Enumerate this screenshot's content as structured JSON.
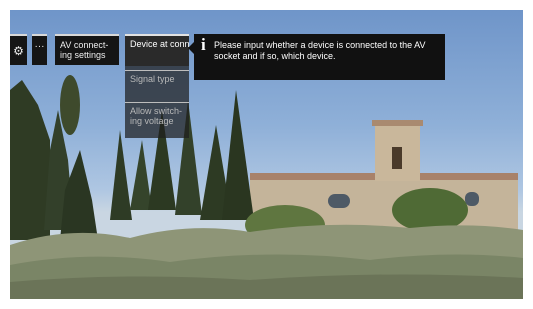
{
  "toolbar": {
    "settings_icon": "gear-icon",
    "more_label": "···",
    "av_label": "AV connect-ing settings"
  },
  "submenu": {
    "items": [
      {
        "label": "Device at connection ..."
      },
      {
        "label": "Signal type"
      },
      {
        "label": "Allow switch-ing voltage"
      }
    ]
  },
  "tooltip": {
    "icon": "info-icon",
    "text": "Please input whether a device is connected to the AV socket and if so, which device."
  }
}
